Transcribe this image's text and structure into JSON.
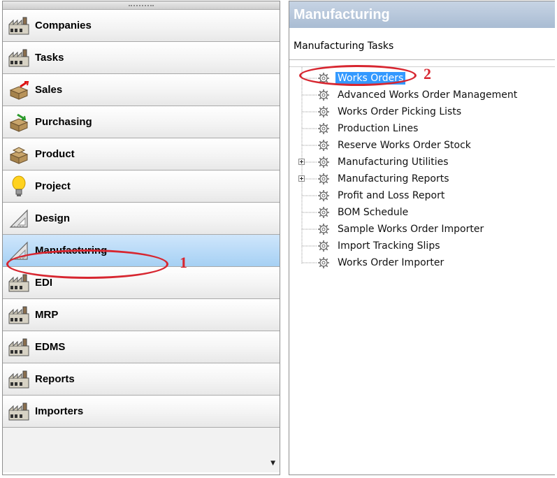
{
  "nav": {
    "items": [
      {
        "label": "Companies",
        "icon": "factory-icon"
      },
      {
        "label": "Tasks",
        "icon": "factory-icon"
      },
      {
        "label": "Sales",
        "icon": "boxes-sales-icon"
      },
      {
        "label": "Purchasing",
        "icon": "boxes-purchasing-icon"
      },
      {
        "label": "Product",
        "icon": "boxes-product-icon"
      },
      {
        "label": "Project",
        "icon": "lightbulb-icon"
      },
      {
        "label": "Design",
        "icon": "set-square-icon"
      },
      {
        "label": "Manufacturing",
        "icon": "set-square-icon",
        "selected": true
      },
      {
        "label": "EDI",
        "icon": "factory-icon"
      },
      {
        "label": "MRP",
        "icon": "factory-icon"
      },
      {
        "label": "EDMS",
        "icon": "factory-icon"
      },
      {
        "label": "Reports",
        "icon": "factory-icon"
      },
      {
        "label": "Importers",
        "icon": "factory-icon"
      }
    ]
  },
  "pane": {
    "title": "Manufacturing",
    "subtitle": "Manufacturing Tasks"
  },
  "tree": {
    "items": [
      {
        "label": "Works Orders",
        "selected": true
      },
      {
        "label": "Advanced Works Order Management"
      },
      {
        "label": "Works Order Picking Lists"
      },
      {
        "label": "Production Lines"
      },
      {
        "label": "Reserve Works Order Stock"
      },
      {
        "label": "Manufacturing Utilities",
        "expandable": true
      },
      {
        "label": "Manufacturing Reports",
        "expandable": true
      },
      {
        "label": "Profit and Loss Report"
      },
      {
        "label": "BOM Schedule"
      },
      {
        "label": "Sample Works Order Importer"
      },
      {
        "label": "Import Tracking Slips"
      },
      {
        "label": "Works Order Importer"
      }
    ]
  },
  "annotations": {
    "step1": "1",
    "step2": "2",
    "color": "#d72630"
  },
  "colors": {
    "selected_nav": "#b6d9f7",
    "selected_tree": "#3399ff",
    "title_bar": "#a9bcd3"
  }
}
